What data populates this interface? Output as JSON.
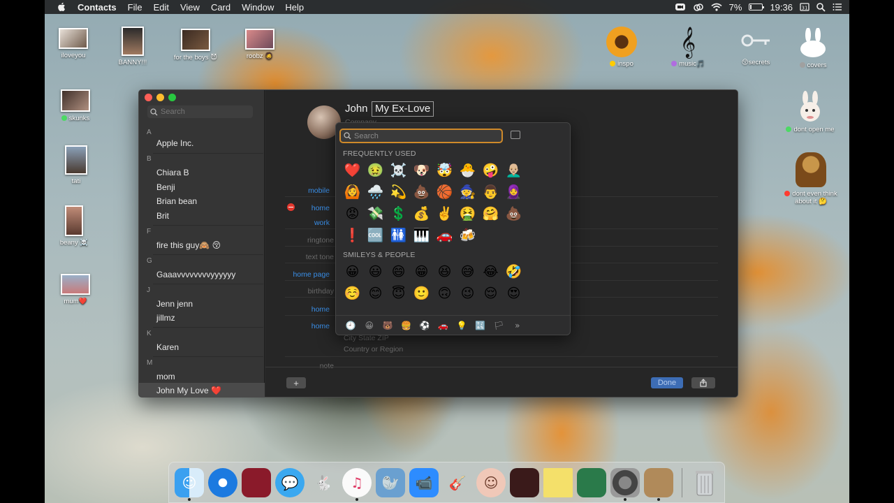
{
  "menubar": {
    "app": "Contacts",
    "menus": [
      "File",
      "Edit",
      "View",
      "Card",
      "Window",
      "Help"
    ],
    "battery_percent": "7%",
    "battery_level": 0.07,
    "time": "19:36"
  },
  "desktop": {
    "icons": [
      {
        "label": "iloveyou"
      },
      {
        "label": "BANNY!!!"
      },
      {
        "label": "for the boys 😈"
      },
      {
        "label": "roobz 🧔"
      },
      {
        "label": "skunks"
      },
      {
        "label": "tati"
      },
      {
        "label": "beany ☠️"
      },
      {
        "label": "mum❤️"
      },
      {
        "label": "inspo"
      },
      {
        "label": "music🎵"
      },
      {
        "label": "😚secrets"
      },
      {
        "label": "covers"
      },
      {
        "label": "dont open me"
      },
      {
        "label": "dont even think about it 🤔"
      }
    ]
  },
  "contacts": {
    "search_placeholder": "Search",
    "groups": [
      {
        "letter": "A",
        "names": [
          "Apple Inc."
        ]
      },
      {
        "letter": "B",
        "names": [
          "Chiara B",
          "Benji",
          "Brian bean",
          "Brit"
        ]
      },
      {
        "letter": "F",
        "names": [
          "fire this guy🙈 😚"
        ]
      },
      {
        "letter": "G",
        "names": [
          "Gaaavvvvvvvvyyyyyy"
        ]
      },
      {
        "letter": "J",
        "names": [
          "Jenn jenn",
          "jillmz"
        ]
      },
      {
        "letter": "K",
        "names": [
          "Karen"
        ]
      },
      {
        "letter": "M",
        "names": [
          "mom",
          "John My Love ❤️"
        ]
      }
    ],
    "selected": "John My Love ❤️"
  },
  "card": {
    "first_name": "John",
    "last_name": "My Ex-Love",
    "company_placeholder": "Company",
    "picture_button": "cture",
    "labels": {
      "mobile": "mobile",
      "home_email": "home",
      "work_email": "work",
      "ringtone": "ringtone",
      "text_tone": "text tone",
      "home_page": "home page",
      "birthday": "birthday",
      "home_phone": "home",
      "home_address": "home",
      "note": "note"
    },
    "address_city": "City  State  ZIP",
    "address_country": "Country or Region",
    "add_button": "+",
    "done_button": "Done"
  },
  "emoji_picker": {
    "search_placeholder": "Search",
    "frequently_used_title": "FREQUENTLY USED",
    "frequently_used": [
      "❤️",
      "🤢",
      "☠️",
      "🐶",
      "🤯",
      "🐣",
      "🤪",
      "👨🏼‍🦲",
      "🙆",
      "🌧️",
      "💫",
      "💩",
      "🏀",
      "🧙",
      "👨",
      "🧕",
      "😡",
      "💸",
      "💲",
      "💰",
      "✌️",
      "🤮",
      "🤗",
      "💩",
      "❗",
      "🆒",
      "🚻",
      "🎹",
      "🚗",
      "🍻"
    ],
    "smileys_title": "SMILEYS & PEOPLE",
    "smileys": [
      "😀",
      "😃",
      "😄",
      "😁",
      "😆",
      "😅",
      "😂",
      "🤣",
      "☺️",
      "😊",
      "😇",
      "🙂",
      "🙃",
      "😉",
      "😌",
      "😍"
    ],
    "categories": [
      "🕘",
      "😀",
      "🐻",
      "🍔",
      "⚽",
      "🚗",
      "💡",
      "🔣",
      "🏳",
      "»"
    ]
  },
  "dock": {
    "apps": [
      "finder-icon",
      "safari-icon",
      "photo-booth-icon",
      "messages-icon",
      "inkscape-icon",
      "itunes-icon",
      "seal-icon",
      "zoom-icon",
      "garageband-icon",
      "face-icon",
      "photo-booth-red-icon",
      "stickies-icon",
      "preview-icon",
      "system-preferences-icon",
      "contacts-icon",
      "trash-icon"
    ]
  }
}
